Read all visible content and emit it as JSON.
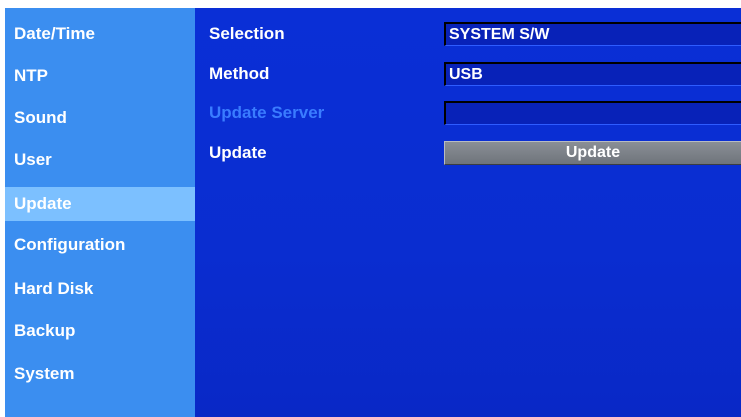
{
  "sidebar": {
    "items": [
      {
        "label": "Date/Time"
      },
      {
        "label": "NTP"
      },
      {
        "label": "Sound"
      },
      {
        "label": "User"
      },
      {
        "label": "Update",
        "selected": true
      },
      {
        "label": "Configuration"
      },
      {
        "label": "Hard Disk"
      },
      {
        "label": "Backup"
      },
      {
        "label": "System"
      }
    ]
  },
  "main": {
    "selection": {
      "label": "Selection",
      "value": "SYSTEM S/W"
    },
    "method": {
      "label": "Method",
      "value": "USB"
    },
    "update_server": {
      "label": "Update Server",
      "value": "",
      "enabled": false
    },
    "update": {
      "label": "Update",
      "button_label": "Update"
    }
  },
  "colors": {
    "sidebar": "#3b8ef0",
    "sidebar_selected": "#7cc0ff",
    "main_background": "#0a2fd6",
    "disabled_label": "#3a7cff",
    "button": "#7a7f86"
  }
}
